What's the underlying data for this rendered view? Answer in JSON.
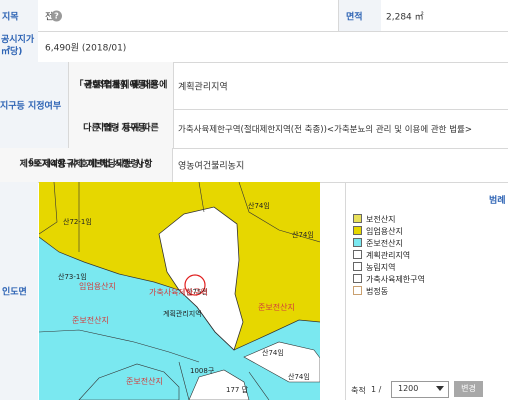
{
  "rows": {
    "jimok_header": "지목",
    "jimok_value": "전",
    "area_header": "면적",
    "area_value": "2,284 ㎡",
    "price_header_1": "공시지가",
    "price_header_2": "㎡당)",
    "price_value": "6,490원 (2018/01)",
    "zone_header": "지구등 지정여부",
    "law1_line1": "「국토의 계획 및 이용에",
    "law1_line2": "관한 법률」에 따른",
    "law1_line3": "지역・지구등",
    "law1_value": "계획관리지역",
    "law2_line1": "다른 법령 등에 따른",
    "law2_line2": "지역・지구등",
    "law2_value": "가축사육제한구역(절대제한지역(전 축종))<가축분뇨의 관리 및 이용에 관한 법률>",
    "reg_line1": "「토지이용규제 기본법 시행령」",
    "reg_line2": "제9조제4항 각 호에 해당되는 사항",
    "reg_value": "영농여건불리농지",
    "map_header": "인도면"
  },
  "legend": {
    "title": "범례",
    "items": [
      {
        "label": "보전산지",
        "color": "#e8e05a"
      },
      {
        "label": "임업용산지",
        "color": "#e6d700"
      },
      {
        "label": "준보전산지",
        "color": "#7ae8f0"
      },
      {
        "label": "계획관리지역",
        "color": "#ffffff"
      },
      {
        "label": "농림지역",
        "color": "#ffffff"
      },
      {
        "label": "가축사육제한구역",
        "color": "#ffffff"
      },
      {
        "label": "법정동",
        "color": "#ffffff"
      }
    ]
  },
  "map": {
    "labels": {
      "l1": "산72-1임",
      "l2": "산74임",
      "l3": "산73-1임",
      "l4": "산74임",
      "l5": "1008구",
      "l6": "177 답",
      "l7": "산74임",
      "l8": "산74임",
      "parcel": "산75전"
    },
    "zones": {
      "z1": "임업용산지",
      "z2": "가축사육제한구역",
      "z3": "준보전산지",
      "z4": "준보전산지",
      "z5": "계획관리지역",
      "z6": "준보전산지"
    }
  },
  "scale": {
    "label": "축적",
    "page": "1 /",
    "value": "1200",
    "button": "변경"
  },
  "colors": {
    "header_blue": "#2d63b4",
    "zone_yellow": "#e6d700",
    "zone_cyan": "#7ae8f0"
  }
}
